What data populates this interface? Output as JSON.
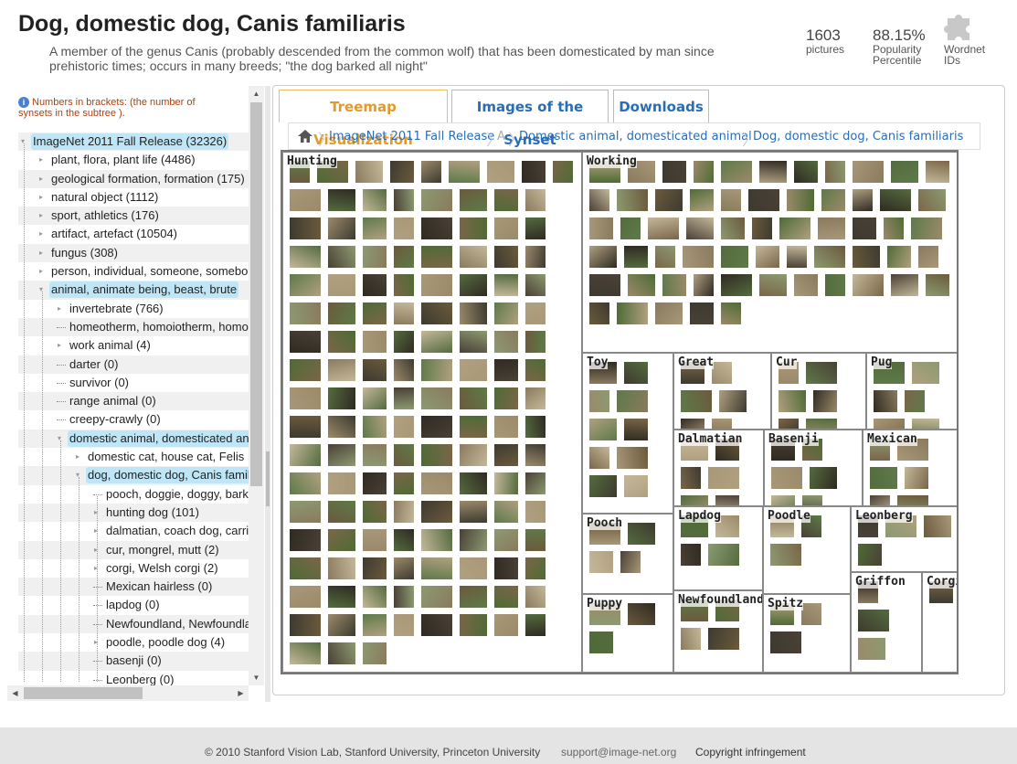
{
  "header": {
    "title": "Dog, domestic dog, Canis familiaris",
    "description": "A member of the genus Canis (probably descended from the common wolf) that has been domesticated by man since prehistoric times; occurs in many breeds; \"the dog barked all night\"",
    "pictures_count": "1603",
    "pictures_label": "pictures",
    "popularity_value": "88.15%",
    "popularity_label_1": "Popularity",
    "popularity_label_2": "Percentile",
    "wordnet_label_1": "Wordnet",
    "wordnet_label_2": "IDs",
    "wordnet_icon": "puzzle-piece-icon"
  },
  "sidebar": {
    "note": "Numbers in brackets: (the number of synsets in the subtree ).",
    "tree": [
      {
        "label": "ImageNet 2011 Fall Release (32326)",
        "level": 0,
        "toggle": "minus",
        "selected": true
      },
      {
        "label": "plant, flora, plant life (4486)",
        "level": 1,
        "toggle": "plus",
        "selected": false
      },
      {
        "label": "geological formation, formation (175)",
        "level": 1,
        "toggle": "plus",
        "selected": false
      },
      {
        "label": "natural object (1112)",
        "level": 1,
        "toggle": "plus",
        "selected": false
      },
      {
        "label": "sport, athletics (176)",
        "level": 1,
        "toggle": "plus",
        "selected": false
      },
      {
        "label": "artifact, artefact (10504)",
        "level": 1,
        "toggle": "plus",
        "selected": false
      },
      {
        "label": "fungus (308)",
        "level": 1,
        "toggle": "plus",
        "selected": false
      },
      {
        "label": "person, individual, someone, somebody",
        "level": 1,
        "toggle": "plus",
        "selected": false
      },
      {
        "label": "animal, animate being, beast, brute",
        "level": 1,
        "toggle": "minus",
        "selected": true
      },
      {
        "label": "invertebrate (766)",
        "level": 2,
        "toggle": "plus",
        "selected": false
      },
      {
        "label": "homeotherm, homoiotherm, homotherm",
        "level": 2,
        "toggle": "none",
        "selected": false
      },
      {
        "label": "work animal (4)",
        "level": 2,
        "toggle": "plus",
        "selected": false
      },
      {
        "label": "darter (0)",
        "level": 2,
        "toggle": "none",
        "selected": false
      },
      {
        "label": "survivor (0)",
        "level": 2,
        "toggle": "none",
        "selected": false
      },
      {
        "label": "range animal (0)",
        "level": 2,
        "toggle": "none",
        "selected": false
      },
      {
        "label": "creepy-crawly (0)",
        "level": 2,
        "toggle": "none",
        "selected": false
      },
      {
        "label": "domestic animal, domesticated animal",
        "level": 2,
        "toggle": "minus",
        "selected": true
      },
      {
        "label": "domestic cat, house cat, Felis",
        "level": 3,
        "toggle": "plus",
        "selected": false
      },
      {
        "label": "dog, domestic dog, Canis familiaris",
        "level": 3,
        "toggle": "minus",
        "selected": true
      },
      {
        "label": "pooch, doggie, doggy, barker",
        "level": 4,
        "toggle": "none",
        "selected": false
      },
      {
        "label": "hunting dog (101)",
        "level": 4,
        "toggle": "plus",
        "selected": false
      },
      {
        "label": "dalmatian, coach dog, carriage dog",
        "level": 4,
        "toggle": "plus",
        "selected": false
      },
      {
        "label": "cur, mongrel, mutt (2)",
        "level": 4,
        "toggle": "plus",
        "selected": false
      },
      {
        "label": "corgi, Welsh corgi (2)",
        "level": 4,
        "toggle": "plus",
        "selected": false
      },
      {
        "label": "Mexican hairless (0)",
        "level": 4,
        "toggle": "none",
        "selected": false
      },
      {
        "label": "lapdog (0)",
        "level": 4,
        "toggle": "none",
        "selected": false
      },
      {
        "label": "Newfoundland, Newfoundland dog",
        "level": 4,
        "toggle": "none",
        "selected": false
      },
      {
        "label": "poodle, poodle dog (4)",
        "level": 4,
        "toggle": "plus",
        "selected": false
      },
      {
        "label": "basenji (0)",
        "level": 4,
        "toggle": "none",
        "selected": false
      },
      {
        "label": "Leonberg (0)",
        "level": 4,
        "toggle": "none",
        "selected": false
      }
    ]
  },
  "tabs": [
    {
      "label": "Treemap Visualization",
      "active": true
    },
    {
      "label": "Images of the Synset",
      "active": false
    },
    {
      "label": "Downloads",
      "active": false
    }
  ],
  "breadcrumb": {
    "home_icon": "home-icon",
    "items": [
      "ImageNet 2011 Fall Release",
      "A",
      "Domestic animal, domesticated animal",
      "Dog, domestic dog, Canis familiaris"
    ]
  },
  "treemap": {
    "cells": [
      {
        "label": "Hunting"
      },
      {
        "label": "Working"
      },
      {
        "label": "Toy"
      },
      {
        "label": "Great"
      },
      {
        "label": "Cur"
      },
      {
        "label": "Pug"
      },
      {
        "label": "Dalmatian"
      },
      {
        "label": "Basenji"
      },
      {
        "label": "Mexican"
      },
      {
        "label": "Pooch"
      },
      {
        "label": "Lapdog"
      },
      {
        "label": "Poodle"
      },
      {
        "label": "Leonberg"
      },
      {
        "label": "Puppy"
      },
      {
        "label": "Newfoundland"
      },
      {
        "label": "Spitz"
      },
      {
        "label": "Griffon"
      },
      {
        "label": "Corgi"
      }
    ]
  },
  "footer": {
    "copyright": "© 2010 Stanford Vision Lab, Stanford University, Princeton University",
    "email": "support@image-net.org",
    "infringement": "Copyright infringement"
  }
}
